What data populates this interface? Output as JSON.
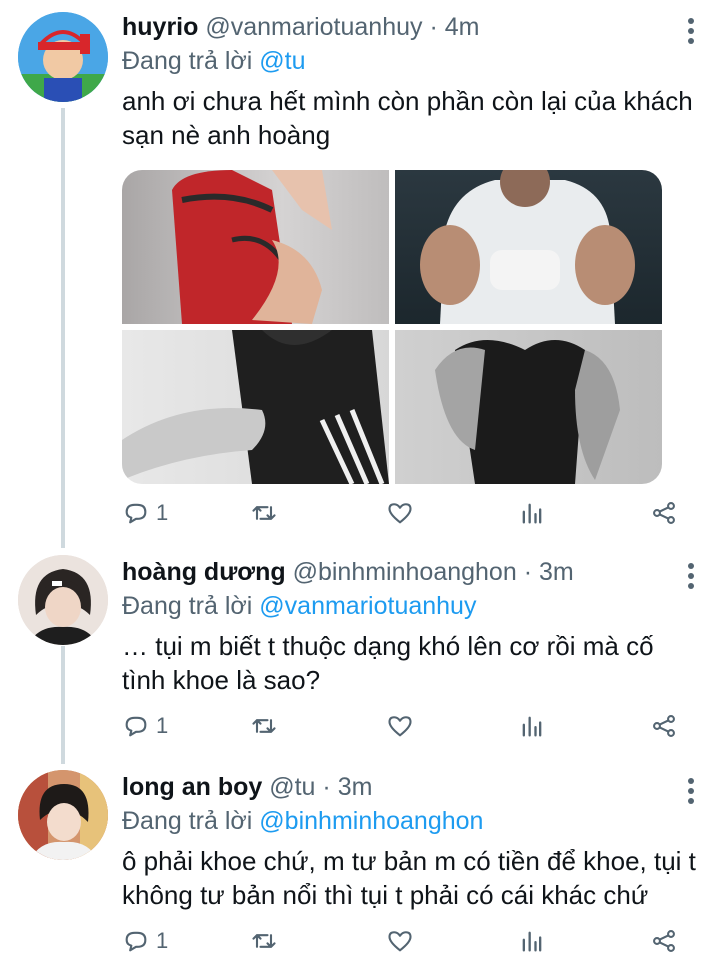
{
  "tweets": [
    {
      "name": "huyrio",
      "handle": "@vanmariotuanhuy",
      "time": "· 4m",
      "reply_prefix": "Đang trả lời",
      "reply_to": "@tu",
      "text": "anh ơi chưa hết mình còn phần còn lại của khách sạn nè anh hoàng",
      "reply_count": "1",
      "photos": [
        "red-sleeveless-top-photo",
        "white-sleeveless-stage-photo",
        "black-sleeveless-grey-photo",
        "black-tank-top-photo"
      ]
    },
    {
      "name": "hoàng dương",
      "handle": "@binhminhoanghon",
      "time": "· 3m",
      "reply_prefix": "Đang trả lời",
      "reply_to": "@vanmariotuanhuy",
      "text": "… tụi m biết t thuộc dạng khó lên cơ rồi mà cố tình khoe là sao?",
      "reply_count": "1"
    },
    {
      "name": "long an boy",
      "handle": "@tu",
      "time": "· 3m",
      "reply_prefix": "Đang trả lời",
      "reply_to": "@binhminhoanghon",
      "text": "ô phải khoe chứ, m tư bản m có tiền để khoe, tụi t không tư bản nổi thì tụi t phải có cái khác chứ",
      "reply_count": "1"
    }
  ],
  "icons": {
    "reply": "reply-icon",
    "retweet": "retweet-icon",
    "like": "heart-icon",
    "views": "analytics-icon",
    "share": "share-icon",
    "more": "more-vertical-icon"
  },
  "colors": {
    "text": "#0f1419",
    "secondary": "#536471",
    "accent": "#1d9bf0",
    "thread_line": "#cfd9de"
  }
}
